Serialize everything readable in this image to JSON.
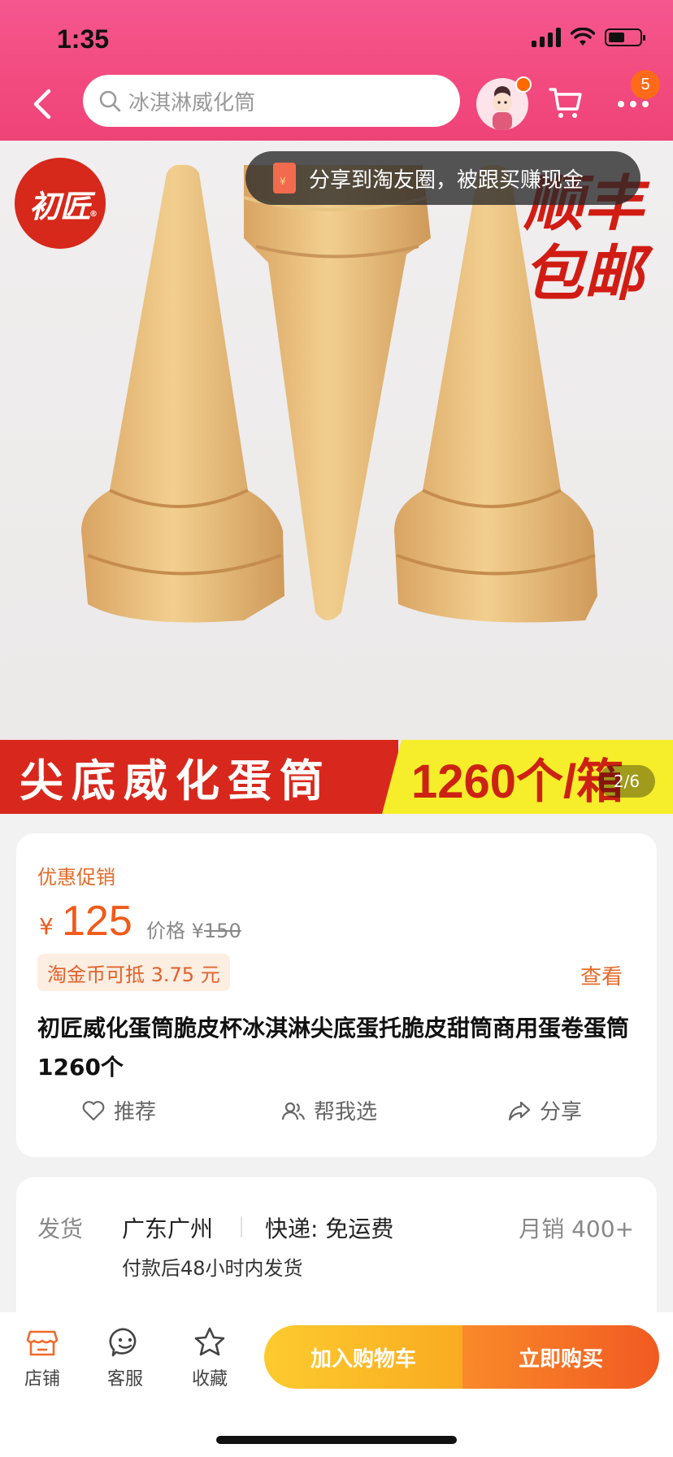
{
  "status_bar": {
    "time": "1:35"
  },
  "header": {
    "search_text": "冰淇淋威化筒",
    "more_badge": "5"
  },
  "gallery": {
    "share_tip": "分享到淘友圈，被跟买赚现金",
    "brand_logo": "初匠",
    "promo_text": "顺丰\n包邮",
    "banner_left": "尖底威化蛋筒",
    "banner_right": "1260个/箱",
    "pager": "2/6"
  },
  "price_card": {
    "promo_label": "优惠促销",
    "currency": "¥",
    "price": "125",
    "orig_label": "价格 ¥",
    "orig_price": "150",
    "coin_tag": "淘金币可抵 3.75 元",
    "view_link": "查看",
    "title": "初匠威化蛋筒脆皮杯冰淇淋尖底蛋托脆皮甜筒商用蛋卷蛋筒 1260个",
    "actions": {
      "recommend": "推荐",
      "help_choose": "帮我选",
      "share": "分享"
    }
  },
  "shipping": {
    "label": "发货",
    "location": "广东广州",
    "express": "快递: 免运费",
    "monthly_sales": "月销  400+",
    "sub": "付款后48小时内发货"
  },
  "bottom_bar": {
    "shop": "店铺",
    "service": "客服",
    "favorite": "收藏",
    "add_cart": "加入购物车",
    "buy_now": "立即购买"
  },
  "colors": {
    "brand_pink": "#f24a7f",
    "accent_orange": "#f05a1a",
    "cart_yellow": "#fccb2f"
  }
}
